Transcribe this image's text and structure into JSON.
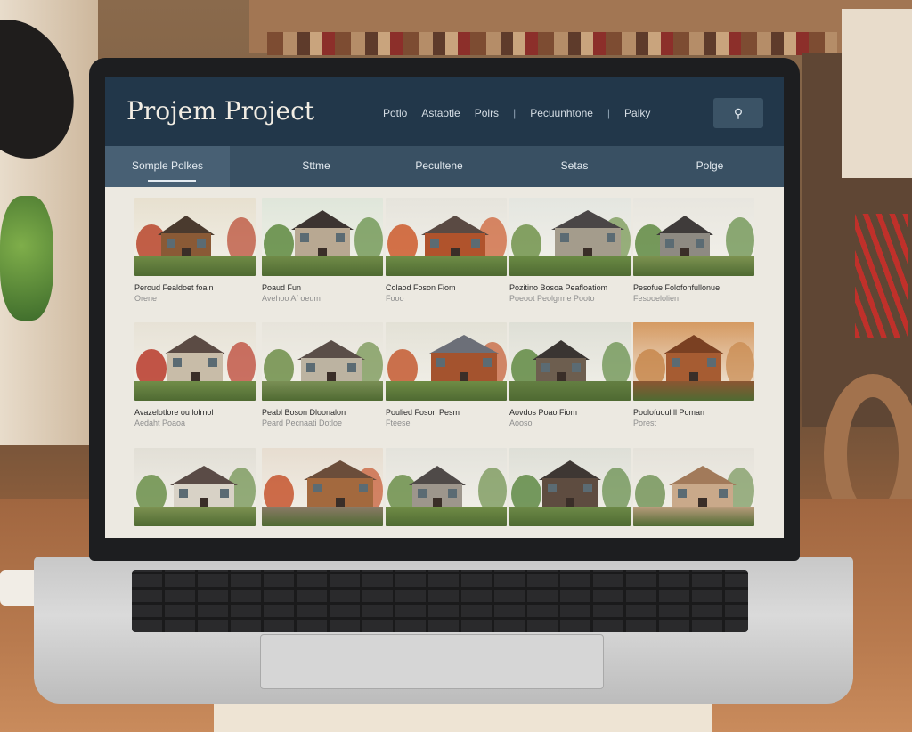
{
  "site": {
    "brand": "Projem Project"
  },
  "topnav": {
    "items": [
      "Potlo",
      "Astaotle",
      "Polrs",
      "Pecuunhtone",
      "Palky"
    ]
  },
  "tabs": [
    "Somple Polkes",
    "Sttme",
    "Pecultene",
    "Setas",
    "Polge"
  ],
  "projects": [
    {
      "title": "Peroud Fealdoet foaln",
      "subtitle": "Orene",
      "palette": {
        "sky": "#e7e0cf",
        "wall": "#8a5a36",
        "roof": "#4a3a2e",
        "tree": "#b8452c",
        "ground": "#6f8a45"
      }
    },
    {
      "title": "Poaud Fun",
      "subtitle": "Avehoo Af oeum",
      "palette": {
        "sky": "#dfe6da",
        "wall": "#b8a892",
        "roof": "#3c3431",
        "tree": "#5e8a3f",
        "ground": "#708b48"
      }
    },
    {
      "title": "Colaod Foson Fiom",
      "subtitle": "Fooo",
      "palette": {
        "sky": "#e6e4dc",
        "wall": "#b0532c",
        "roof": "#5a4a43",
        "tree": "#cc5a2c",
        "ground": "#6e8c46"
      }
    },
    {
      "title": "Pozitino Bosoa Peafloatiom",
      "subtitle": "Poeoot Peolgrme Pooto",
      "palette": {
        "sky": "#e4e6e0",
        "wall": "#a49c8c",
        "roof": "#4a4646",
        "tree": "#71934b",
        "ground": "#6a8a44"
      }
    },
    {
      "title": "Pesofue Folofonfullonue",
      "subtitle": "Fesooelolien",
      "palette": {
        "sky": "#e8e6df",
        "wall": "#8e8a82",
        "roof": "#3f3b3a",
        "tree": "#5f8a42",
        "ground": "#7c9250"
      }
    },
    {
      "title": "Avazelotlore ou lolrnol",
      "subtitle": "Aedaht Poaoa",
      "palette": {
        "sky": "#e7e2d6",
        "wall": "#c8bca8",
        "roof": "#5b4b44",
        "tree": "#b93a2a",
        "ground": "#718d49"
      }
    },
    {
      "title": "Peabl Boson Dloonalon",
      "subtitle": "Peard Pecnaati Dotloe",
      "palette": {
        "sky": "#e7e4db",
        "wall": "#bcb3a1",
        "roof": "#5a4e48",
        "tree": "#6e8e49",
        "ground": "#7a8f55"
      }
    },
    {
      "title": "Poulied Foson Pesm",
      "subtitle": "Fteese",
      "palette": {
        "sky": "#e3e1d6",
        "wall": "#a4532e",
        "roof": "#6c6f78",
        "tree": "#c45a31",
        "ground": "#6f8c45"
      }
    },
    {
      "title": "Aovdos Poao Fiom",
      "subtitle": "Aooso",
      "palette": {
        "sky": "#dedfd6",
        "wall": "#6d5e4f",
        "roof": "#3a3532",
        "tree": "#608a43",
        "ground": "#647f42"
      }
    },
    {
      "title": "Poolofuoul ll Poman",
      "subtitle": "Porest",
      "palette": {
        "sky": "#d59a62",
        "wall": "#a65c32",
        "roof": "#7a4022",
        "tree": "#c7874c",
        "ground": "#8b5632"
      }
    },
    {
      "title": "",
      "subtitle": "",
      "palette": {
        "sky": "#e2dfd6",
        "wall": "#d8d2c6",
        "roof": "#5a4b46",
        "tree": "#6b8f4a",
        "ground": "#7d9252"
      }
    },
    {
      "title": "",
      "subtitle": "",
      "palette": {
        "sky": "#e7ddd0",
        "wall": "#a3693e",
        "roof": "#6b4d3a",
        "tree": "#c6552e",
        "ground": "#8a7a66"
      }
    },
    {
      "title": "",
      "subtitle": "",
      "palette": {
        "sky": "#e4e3dc",
        "wall": "#9d968c",
        "roof": "#4f4a48",
        "tree": "#6c8f4a",
        "ground": "#708c46"
      }
    },
    {
      "title": "",
      "subtitle": "",
      "palette": {
        "sky": "#dedfd7",
        "wall": "#5e4c40",
        "roof": "#3e3733",
        "tree": "#5f8945",
        "ground": "#6d8a48"
      }
    },
    {
      "title": "",
      "subtitle": "",
      "palette": {
        "sky": "#e5e2da",
        "wall": "#c9a98a",
        "roof": "#a27a5a",
        "tree": "#76955a",
        "ground": "#b99c7c"
      }
    }
  ]
}
